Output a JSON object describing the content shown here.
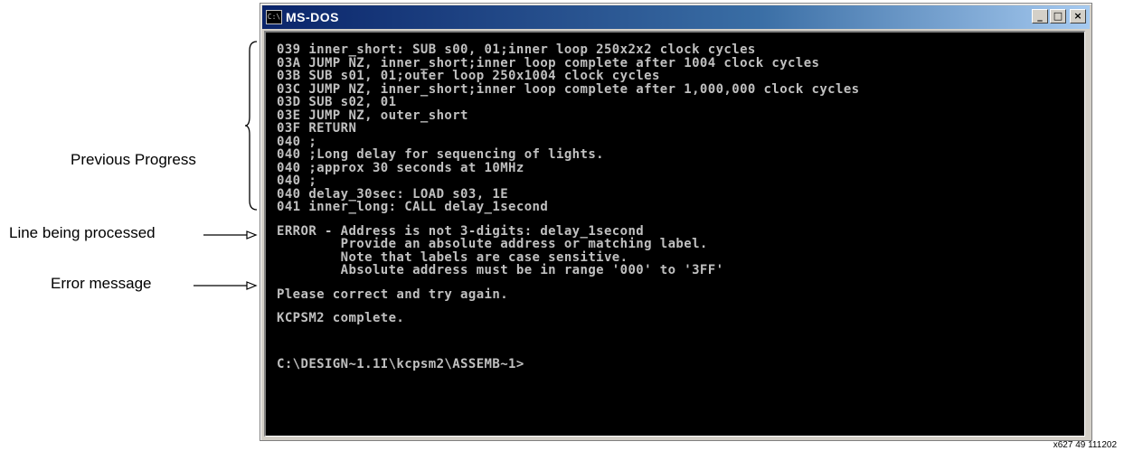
{
  "annotations": {
    "previous_progress": "Previous Progress",
    "line_processed": "Line being processed",
    "error_message": "Error message"
  },
  "window": {
    "title": "MS-DOS",
    "icon_label": "C:\\",
    "buttons": {
      "minimize": "_",
      "maximize": "□",
      "close": "×"
    }
  },
  "console": {
    "history": [
      "039 inner_short: SUB s00, 01;inner loop 250x2x2 clock cycles",
      "03A JUMP NZ, inner_short;inner loop complete after 1004 clock cycles",
      "03B SUB s01, 01;outer loop 250x1004 clock cycles",
      "03C JUMP NZ, inner_short;inner loop complete after 1,000,000 clock cycles",
      "03D SUB s02, 01",
      "03E JUMP NZ, outer_short",
      "03F RETURN",
      "040 ;",
      "040 ;Long delay for sequencing of lights.",
      "040 ;approx 30 seconds at 10MHz",
      "040 ;",
      "040 delay_30sec: LOAD s03, 1E"
    ],
    "current_line": "041 inner_long: CALL delay_1second",
    "error_lines": [
      "ERROR - Address is not 3-digits: delay_1second",
      "        Provide an absolute address or matching label.",
      "        Note that labels are case sensitive.",
      "        Absolute address must be in range '000' to '3FF'"
    ],
    "retry": "Please correct and try again.",
    "complete": "KCPSM2 complete.",
    "prompt": "C:\\DESIGN~1.1I\\kcpsm2\\ASSEMB~1>"
  },
  "figure_id": "x627_49_111202"
}
